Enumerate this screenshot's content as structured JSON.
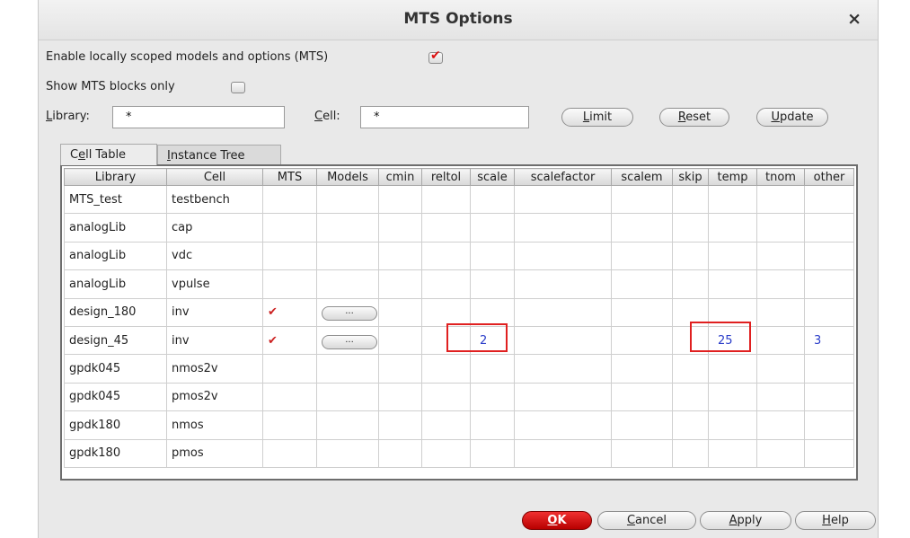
{
  "window": {
    "title": "MTS Options",
    "close_symbol": "×"
  },
  "options": {
    "enable_mts_label": "Enable locally scoped models and options (MTS)",
    "enable_mts_checked": true,
    "show_blocks_label": "Show MTS blocks only",
    "show_blocks_checked": false
  },
  "filter": {
    "library_label_first": "L",
    "library_label_rest": "ibrary:",
    "library_value": "*",
    "cell_label_first": "C",
    "cell_label_rest": "ell:",
    "cell_value": "*"
  },
  "buttons": {
    "limit_first": "L",
    "limit_rest": "imit",
    "reset_first": "R",
    "reset_rest": "eset",
    "update_first": "U",
    "update_rest": "pdate",
    "dots": "...",
    "ok_first": "O",
    "ok_rest": "K",
    "cancel_first": "C",
    "cancel_rest": "ancel",
    "apply_first": "A",
    "apply_rest": "pply",
    "help_first": "H",
    "help_rest": "elp"
  },
  "tabs": {
    "cell_table_pre": "C",
    "cell_table_u": "e",
    "cell_table_post": "ll Table",
    "instance_tree_u": "I",
    "instance_tree_post": "nstance Tree"
  },
  "table": {
    "columns": [
      "Library",
      "Cell",
      "MTS",
      "Models",
      "cmin",
      "reltol",
      "scale",
      "scalefactor",
      "scalem",
      "skip",
      "temp",
      "tnom",
      "other"
    ],
    "rows": [
      {
        "library": "MTS_test",
        "cell": "testbench",
        "mts": "",
        "models": "",
        "scale": "",
        "temp": "",
        "other": ""
      },
      {
        "library": "analogLib",
        "cell": "cap",
        "mts": "",
        "models": "",
        "scale": "",
        "temp": "",
        "other": ""
      },
      {
        "library": "analogLib",
        "cell": "vdc",
        "mts": "",
        "models": "",
        "scale": "",
        "temp": "",
        "other": ""
      },
      {
        "library": "analogLib",
        "cell": "vpulse",
        "mts": "",
        "models": "",
        "scale": "",
        "temp": "",
        "other": ""
      },
      {
        "library": "design_180",
        "cell": "inv",
        "mts": "✔",
        "models": "...",
        "scale": "",
        "temp": "",
        "other": ""
      },
      {
        "library": "design_45",
        "cell": "inv",
        "mts": "✔",
        "models": "...",
        "scale": "2",
        "temp": "25",
        "other": "3"
      },
      {
        "library": "gpdk045",
        "cell": "nmos2v",
        "mts": "",
        "models": "",
        "scale": "",
        "temp": "",
        "other": ""
      },
      {
        "library": "gpdk045",
        "cell": "pmos2v",
        "mts": "",
        "models": "",
        "scale": "",
        "temp": "",
        "other": ""
      },
      {
        "library": "gpdk180",
        "cell": "nmos",
        "mts": "",
        "models": "",
        "scale": "",
        "temp": "",
        "other": ""
      },
      {
        "library": "gpdk180",
        "cell": "pmos",
        "mts": "",
        "models": "",
        "scale": "",
        "temp": "",
        "other": ""
      }
    ]
  },
  "colors": {
    "accent_red": "#d11",
    "value_blue": "#2a3dc9",
    "highlight_red": "#e02020"
  }
}
